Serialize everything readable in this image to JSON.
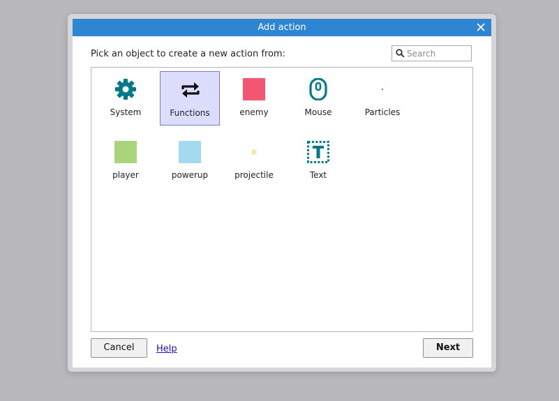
{
  "dialog": {
    "title": "Add action",
    "close_icon": "close-icon",
    "prompt": "Pick an object to create a new action from:"
  },
  "search": {
    "icon": "search-icon",
    "placeholder": "Search",
    "value": ""
  },
  "objects": [
    {
      "label": "System",
      "icon": "gear-icon",
      "color": "#007a87",
      "selected": false
    },
    {
      "label": "Functions",
      "icon": "repeat-arrows-icon",
      "color": "#111111",
      "selected": true
    },
    {
      "label": "enemy",
      "icon": "sprite-swatch-icon",
      "color": "#f25670",
      "selected": false
    },
    {
      "label": "Mouse",
      "icon": "mouse-icon",
      "color": "#007a87",
      "selected": false
    },
    {
      "label": "Particles",
      "icon": "particle-dot-icon",
      "color": "#e8004c",
      "selected": false
    },
    {
      "label": "player",
      "icon": "sprite-swatch-icon",
      "color": "#a8d47a",
      "selected": false
    },
    {
      "label": "powerup",
      "icon": "sprite-swatch-icon",
      "color": "#a3d9ef",
      "selected": false
    },
    {
      "label": "projectile",
      "icon": "sprite-swatch-icon",
      "color": "#f7eaa0",
      "selected": false
    },
    {
      "label": "Text",
      "icon": "text-object-icon",
      "color": "#007a87",
      "selected": false
    }
  ],
  "buttons": {
    "cancel": "Cancel",
    "help": "Help",
    "next": "Next"
  },
  "colors": {
    "titlebar": "#2e86d3",
    "selection_bg": "#dcdcfd",
    "selection_border": "#7b7bd0",
    "link": "#1a0dcc"
  }
}
